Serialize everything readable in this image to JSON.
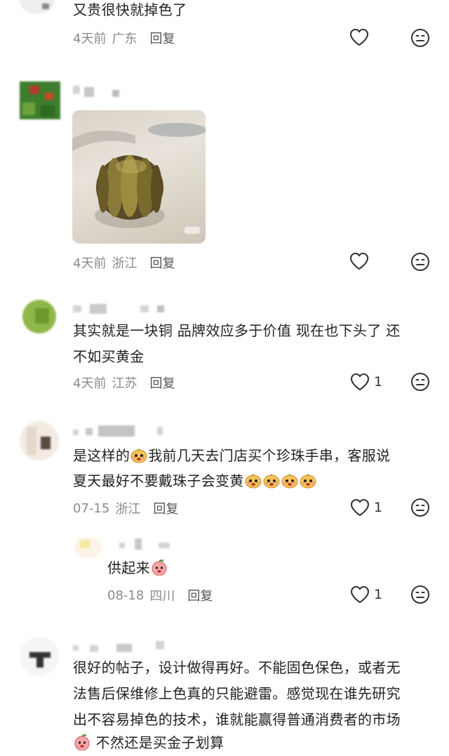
{
  "comments": [
    {
      "id": "c1",
      "text": "又贵很快就掉色了",
      "time": "4天前",
      "location": "广东",
      "reply": "回复",
      "likes": ""
    },
    {
      "id": "c2",
      "text": "",
      "time": "4天前",
      "location": "浙江",
      "reply": "回复",
      "likes": ""
    },
    {
      "id": "c3",
      "text_line1": "其实就是一块铜 品牌效应多于价值 现在也下头了 还",
      "text_line2": "不如买黄金",
      "time": "4天前",
      "location": "江苏",
      "reply": "回复",
      "likes": "1"
    },
    {
      "id": "c4",
      "text_line1a": "是这样的",
      "text_line1b": "我前几天去门店买个珍珠手串，客服说",
      "text_line2": "夏天最好不要戴珠子会变黄",
      "time": "07-15",
      "location": "浙江",
      "reply": "回复",
      "likes": "1"
    },
    {
      "id": "c4r1",
      "text": "供起来",
      "time": "08-18",
      "location": "四川",
      "reply": "回复",
      "likes": "1"
    },
    {
      "id": "c5",
      "text_line1": "很好的帖子，设计做得再好。不能固色保色，或者无",
      "text_line2": "法售后保维修上色真的只能避雷。感觉现在谁先研究",
      "text_line3": "出不容易掉色的技术，谁就能赢得普通消费者的市场",
      "text_line4": "不然还是买金子划算"
    }
  ],
  "colors": {
    "text": "#222222",
    "meta": "#8a8a8a",
    "icon": "#333333"
  },
  "icons": [
    "heart-icon",
    "meh-face-icon",
    "pumpkin-emoji",
    "peach-emoji"
  ]
}
